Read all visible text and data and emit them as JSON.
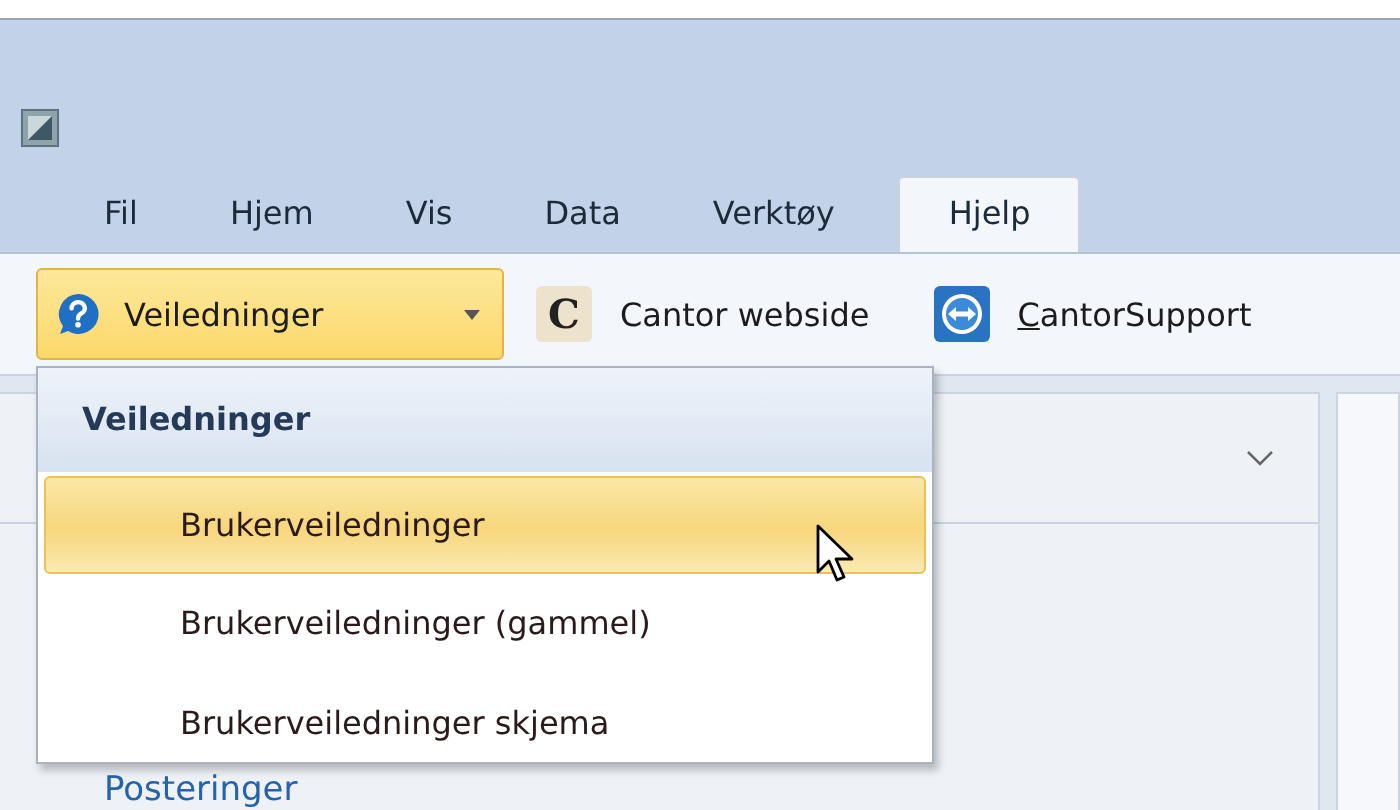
{
  "tabs": [
    {
      "label": "Fil",
      "selected": false
    },
    {
      "label": "Hjem",
      "selected": false
    },
    {
      "label": "Vis",
      "selected": false
    },
    {
      "label": "Data",
      "selected": false
    },
    {
      "label": "Verktøy",
      "selected": false
    },
    {
      "label": "Hjelp",
      "selected": true
    }
  ],
  "toolbar": {
    "dropdown": {
      "label": "Veiledninger",
      "open": true
    },
    "buttons": [
      {
        "label": "Cantor webside",
        "kind": "letter",
        "icon_text": "C",
        "access_key": false
      },
      {
        "label": "CantorSupport",
        "kind": "remote",
        "access_key": true
      }
    ]
  },
  "menu": {
    "header": "Veiledninger",
    "items": [
      {
        "label": "Brukerveiledninger",
        "selected": true
      },
      {
        "label": "Brukerveiledninger (gammel)",
        "selected": false
      },
      {
        "label": "Brukerveiledninger skjema",
        "selected": false
      }
    ]
  },
  "panel": {
    "section_title": "Posteringer"
  }
}
